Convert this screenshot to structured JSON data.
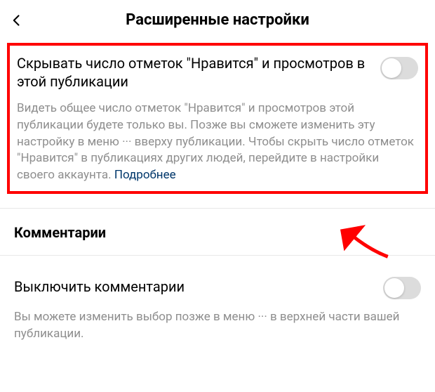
{
  "header": {
    "title": "Расширенные настройки"
  },
  "hide_likes": {
    "title": "Скрывать число отметок \"Нравится\" и просмотров в этой публикации",
    "description": "Видеть общее число отметок \"Нравится\" и просмотров этой публикации будете только вы. Позже вы сможете изменить эту настройку в меню ··· вверху публикации. Чтобы скрыть число отметок \"Нравится\" в публикациях других людей, перейдите в настройки своего аккаунта. ",
    "learn_more": "Подробнее",
    "enabled": false
  },
  "comments": {
    "section_label": "Комментарии",
    "disable_title": "Выключить комментарии",
    "disable_description": "Вы можете изменить выбор позже в меню ··· в верхней части вашей публикации.",
    "enabled": false
  }
}
